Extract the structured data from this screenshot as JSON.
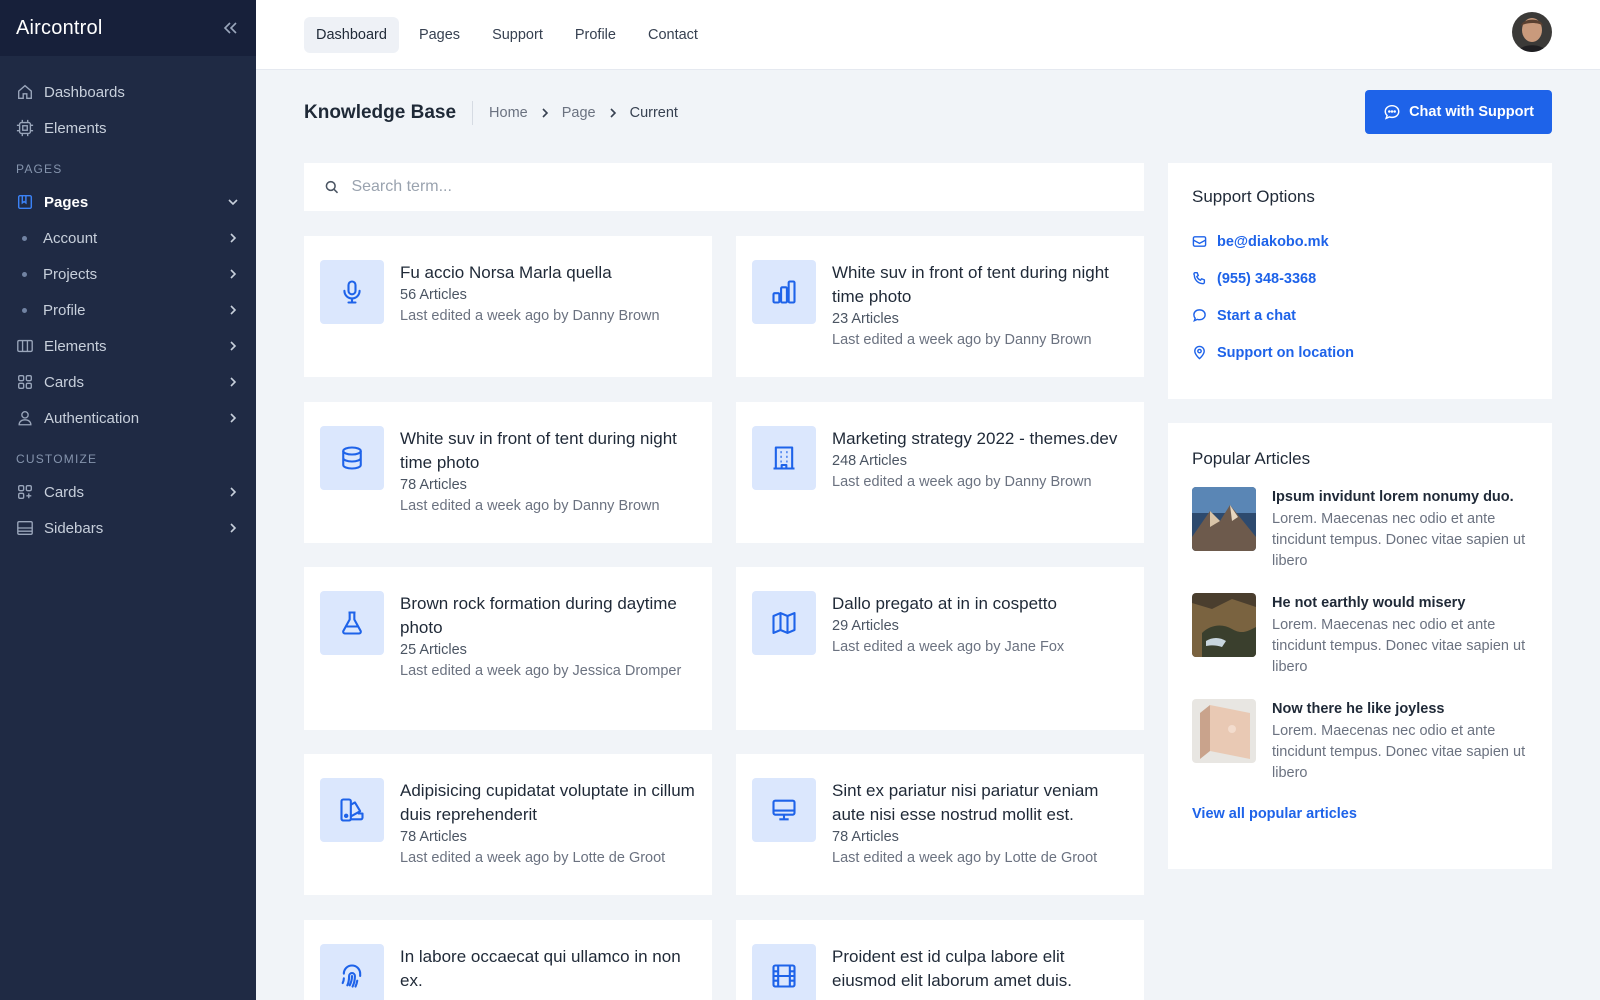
{
  "brand": {
    "name": "Aircontrol"
  },
  "sidebar": {
    "top": [
      {
        "label": "Dashboards",
        "icon": "home-icon"
      },
      {
        "label": "Elements",
        "icon": "chip-icon"
      }
    ],
    "pages_section": "PAGES",
    "pages": {
      "label": "Pages",
      "icon": "book-icon"
    },
    "pages_sub": [
      {
        "label": "Account"
      },
      {
        "label": "Projects"
      },
      {
        "label": "Profile"
      }
    ],
    "more": [
      {
        "label": "Elements",
        "icon": "columns-icon"
      },
      {
        "label": "Cards",
        "icon": "grid-icon"
      },
      {
        "label": "Authentication",
        "icon": "user-icon"
      }
    ],
    "customize_section": "CUSTOMIZE",
    "customize": [
      {
        "label": "Cards",
        "icon": "grid-plus-icon"
      },
      {
        "label": "Sidebars",
        "icon": "sidebar-icon"
      }
    ]
  },
  "topnav": [
    "Dashboard",
    "Pages",
    "Support",
    "Profile",
    "Contact"
  ],
  "header": {
    "title": "Knowledge Base",
    "breadcrumb": [
      "Home",
      "Page",
      "Current"
    ],
    "chat_button": "Chat with Support"
  },
  "search": {
    "placeholder": "Search term..."
  },
  "cards": [
    {
      "icon": "microphone-icon",
      "title": "Fu accio Norsa Marla quella",
      "articles": "56 Articles",
      "edited": "Last edited a week ago by Danny Brown"
    },
    {
      "icon": "bar-chart-icon",
      "title": "White suv in front of tent during night time photo",
      "articles": "23 Articles",
      "edited": "Last edited a week ago by Danny Brown"
    },
    {
      "icon": "database-icon",
      "title": "White suv in front of tent during night time photo",
      "articles": "78 Articles",
      "edited": "Last edited a week ago by Danny Brown"
    },
    {
      "icon": "building-icon",
      "title": "Marketing strategy 2022 - themes.dev",
      "articles": "248 Articles",
      "edited": "Last edited a week ago by Danny Brown"
    },
    {
      "icon": "flask-icon",
      "title": "Brown rock formation during daytime photo",
      "articles": "25 Articles",
      "edited": "Last edited a week ago by Jessica Dromper"
    },
    {
      "icon": "map-icon",
      "title": "Dallo pregato at in in cospetto",
      "articles": "29 Articles",
      "edited": "Last edited a week ago by Jane Fox"
    },
    {
      "icon": "swatch-icon",
      "title": "Adipisicing cupidatat voluptate in cillum duis reprehenderit",
      "articles": "78 Articles",
      "edited": "Last edited a week ago by Lotte de Groot"
    },
    {
      "icon": "monitor-icon",
      "title": "Sint ex pariatur nisi pariatur veniam aute nisi esse nostrud mollit est.",
      "articles": "78 Articles",
      "edited": "Last edited a week ago by Lotte de Groot"
    },
    {
      "icon": "fingerprint-icon",
      "title": "In labore occaecat qui ullamco in non ex.",
      "articles": "",
      "edited": ""
    },
    {
      "icon": "film-icon",
      "title": "Proident est id culpa labore elit eiusmod elit laborum amet duis.",
      "articles": "",
      "edited": ""
    }
  ],
  "support": {
    "title": "Support Options",
    "links": [
      {
        "icon": "mail-icon",
        "label": "be@diakobo.mk"
      },
      {
        "icon": "phone-icon",
        "label": "(955) 348-3368"
      },
      {
        "icon": "chat-icon",
        "label": "Start a chat"
      },
      {
        "icon": "location-icon",
        "label": "Support on location"
      }
    ]
  },
  "popular": {
    "title": "Popular Articles",
    "items": [
      {
        "title": "Ipsum invidunt lorem nonumy duo.",
        "body": "Lorem. Maecenas nec odio et ante tincidunt tempus. Donec vitae sapien ut libero"
      },
      {
        "title": "He not earthly would misery",
        "body": "Lorem. Maecenas nec odio et ante tincidunt tempus. Donec vitae sapien ut libero"
      },
      {
        "title": "Now there he like joyless",
        "body": "Lorem. Maecenas nec odio et ante tincidunt tempus. Donec vitae sapien ut libero"
      }
    ],
    "view_all": "View all popular articles"
  },
  "colors": {
    "accent": "#1e63e9",
    "sidebar": "#1f2a44",
    "icon_bg": "#dbe7fd"
  }
}
